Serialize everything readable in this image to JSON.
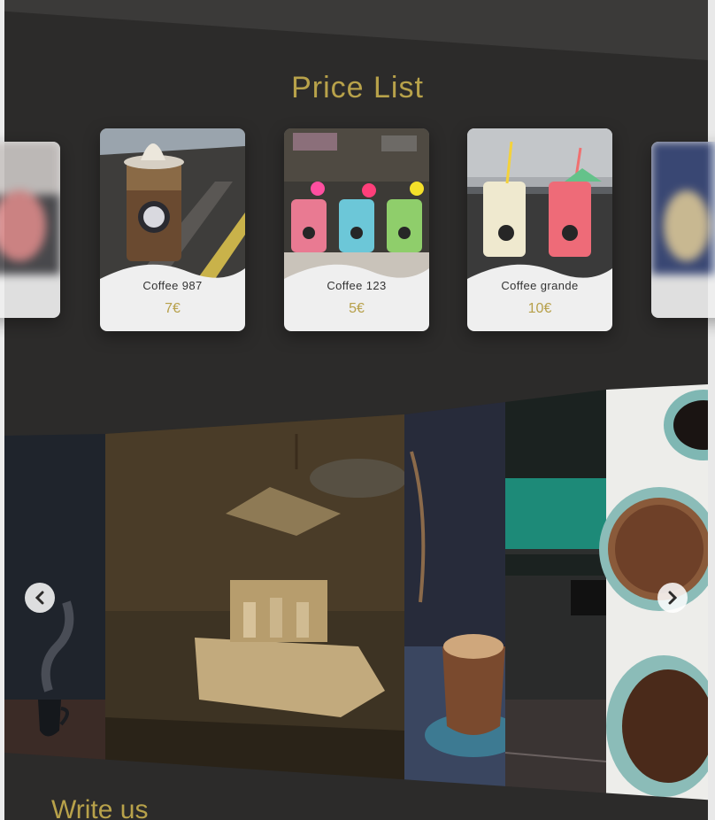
{
  "section": {
    "title": "Price List",
    "next_heading": "Write us"
  },
  "price_list": {
    "items": [
      {
        "name": "Coffee 987",
        "price": "7€"
      },
      {
        "name": "Coffee 123",
        "price": "5€"
      },
      {
        "name": "Coffee grande",
        "price": "10€"
      }
    ]
  },
  "gallery": {
    "prev_icon": "chevron-left-icon",
    "next_icon": "chevron-right-icon"
  },
  "colors": {
    "accent": "#b8a24a",
    "background": "#2c2b2a",
    "card": "#efefef"
  }
}
